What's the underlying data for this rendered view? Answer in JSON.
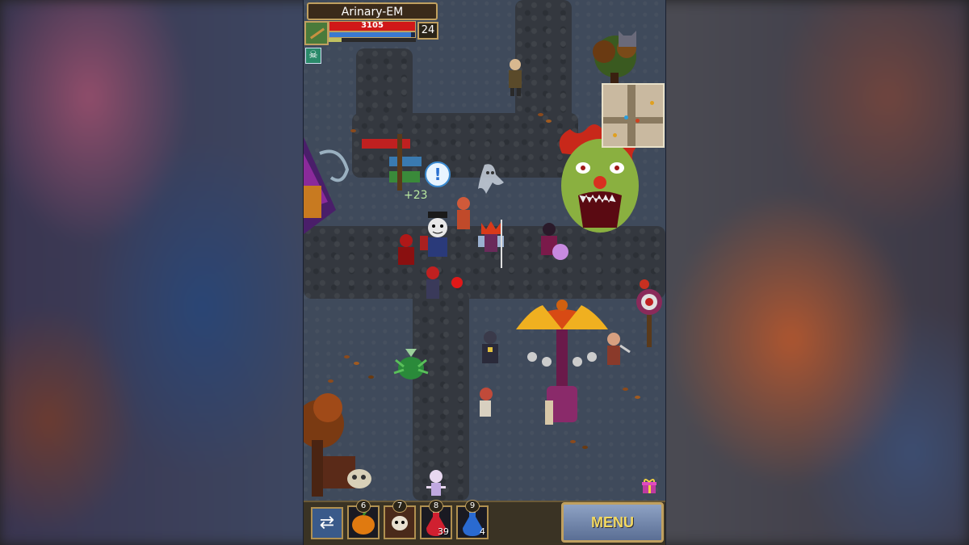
{
  "player": {
    "name": "Arinary-EM",
    "hp_text": "3105",
    "hp_fraction": 1.0,
    "mp_fraction": 0.95,
    "xp_fraction": 0.15,
    "level": "24"
  },
  "status_icon": "skull-crossbones-icon",
  "floating_text": "+23",
  "speech_bubble": "!",
  "quickbar": {
    "swap_icon": "swap-arrows-icon",
    "slots": [
      {
        "icon": "pumpkin-bomb-icon",
        "count": "6",
        "qty": ""
      },
      {
        "icon": "skull-spell-icon",
        "count": "7",
        "qty": ""
      },
      {
        "icon": "health-potion-icon",
        "count": "8",
        "qty": "39"
      },
      {
        "icon": "mana-potion-icon",
        "count": "9",
        "qty": "4"
      }
    ]
  },
  "menu_label": "MENU",
  "colors": {
    "hp": "#d01818",
    "mp": "#3a7ad0",
    "menu_text": "#f2d860"
  }
}
